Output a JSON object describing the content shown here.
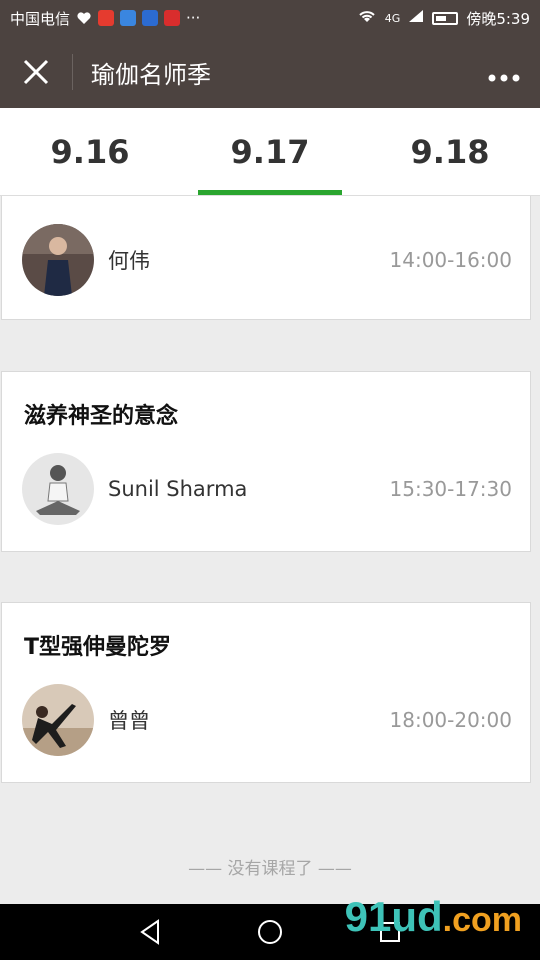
{
  "status_bar": {
    "carrier": "中国电信",
    "indicators": [
      "heart-icon",
      "weibo-icon",
      "maps-icon",
      "baidu-icon",
      "news-icon"
    ],
    "ellipsis": "···",
    "network": "4G",
    "time": "傍晚5:39"
  },
  "nav": {
    "close_icon": "close-icon",
    "title": "瑜伽名师季",
    "more_icon": "more-icon"
  },
  "tabs": [
    {
      "label": "9.16",
      "active": false
    },
    {
      "label": "9.17",
      "active": true
    },
    {
      "label": "9.18",
      "active": false
    }
  ],
  "sessions": [
    {
      "title": "",
      "teacher": "何伟",
      "time": "14:00-16:00"
    },
    {
      "title": "滋养神圣的意念",
      "teacher": "Sunil Sharma",
      "time": "15:30-17:30"
    },
    {
      "title": "T型强伸曼陀罗",
      "teacher": "曾曾",
      "time": "18:00-20:00"
    }
  ],
  "footer": {
    "no_more": "—— 没有课程了 ——"
  },
  "watermark": {
    "brand": "91ud",
    "suffix": ".com"
  },
  "colors": {
    "header_bg": "#4c4340",
    "tab_indicator": "#2aa52f",
    "page_bg": "#ececec",
    "time_text": "#999999"
  }
}
